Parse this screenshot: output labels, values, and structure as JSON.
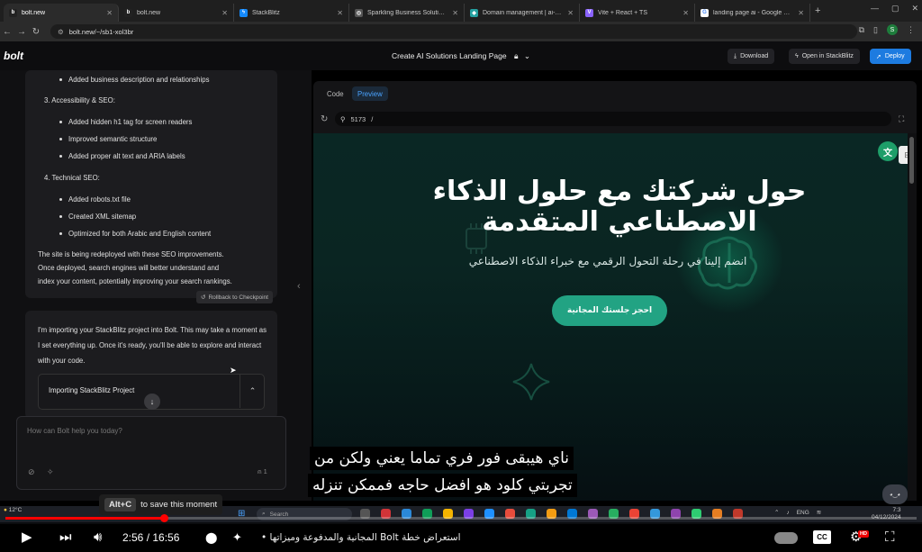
{
  "browser": {
    "tabs": [
      {
        "title": "bolt.new",
        "icon": "bolt-favicon",
        "active": true
      },
      {
        "title": "bolt.new",
        "icon": "bolt-favicon",
        "active": false
      },
      {
        "title": "StackBlitz",
        "icon": "stackblitz-favicon",
        "active": false
      },
      {
        "title": "Sparkling Business Solutions -",
        "icon": "globe-favicon",
        "active": false
      },
      {
        "title": "Domain management | ai-sparkl",
        "icon": "netlify-favicon",
        "active": false
      },
      {
        "title": "Vite + React + TS",
        "icon": "vite-favicon",
        "active": false
      },
      {
        "title": "landing page ai - Google Search",
        "icon": "google-favicon",
        "active": false
      }
    ],
    "new_tab_icon": "+",
    "url": "bolt.new/~/sb1-xol3br",
    "profile_initial": "S"
  },
  "bolt": {
    "logo": "bolt",
    "project_title": "Create AI Solutions Landing Page",
    "download_label": "Download",
    "open_stackblitz_label": "Open in StackBlitz",
    "deploy_label": "Deploy"
  },
  "chat": {
    "message1": {
      "lines": [
        "Added business description and relationships",
        "3. Accessibility & SEO:",
        "Added hidden h1 tag for screen readers",
        "Improved semantic structure",
        "Added proper alt text and ARIA labels",
        "4. Technical SEO:",
        "Added robots.txt file",
        "Created XML sitemap",
        "Optimized for both Arabic and English content",
        "The site is being redeployed with these SEO improvements.",
        "Once deployed, search engines will better understand and",
        "index your content, potentially improving your search rankings."
      ]
    },
    "rollback_label": "Rollback to Checkpoint",
    "message2": {
      "text": "I'm importing your StackBlitz project into Bolt. This may take a moment as I set everything up. Once it's ready, you'll be able to explore and interact with your code.",
      "import_label": "Importing StackBlitz Project"
    },
    "input_placeholder": "How can Bolt help you today?",
    "char_count": "1"
  },
  "preview": {
    "code_tab": "Code",
    "preview_tab": "Preview",
    "port": "5173",
    "path": "/",
    "hero_title": "حول شركتك مع حلول الذكاء الاصطناعي المتقدمة",
    "hero_subtitle": "انضم إلينا في رحلة التحول الرقمي مع خبراء الذكاء الاصطناعي",
    "cta_label": "احجز جلستك المجانية",
    "accent_color": "#22a383"
  },
  "subtitles": {
    "line1": "ناي هيبقى فور فري تماما يعني ولكن من",
    "line2": "تجربتي كلود هو افضل حاجه فممكن تنزله"
  },
  "tooltip": {
    "shortcut": "Alt+C",
    "text": "to save this moment"
  },
  "taskbar": {
    "weather_temp": "12°C",
    "search_placeholder": "Search",
    "lang": "ENG",
    "time": "7:3",
    "date": "04/12/2024"
  },
  "player": {
    "time_current": "2:56",
    "time_total": "16:56",
    "time_display": "2:56 / 16:56",
    "progress_fraction": 0.174,
    "chapter_title": "استعراض خطة Bolt المجانية والمدفوعة وميزاتها •"
  }
}
